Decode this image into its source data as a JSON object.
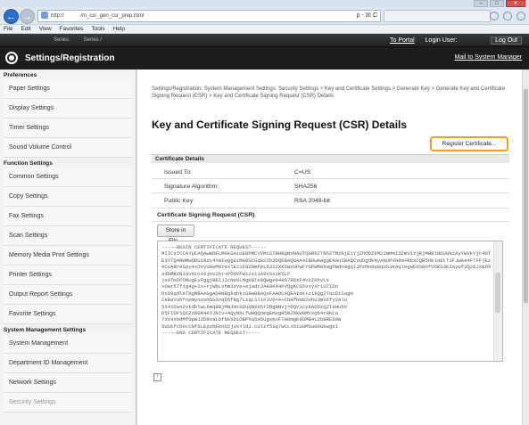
{
  "browser": {
    "url": "http://           /m_csr_gen_csr_prep.html",
    "address_tools": "ρ - ☒ C",
    "window_buttons": {
      "minimize": "–",
      "maximize": "□",
      "close": "✕"
    },
    "menu": [
      "File",
      "Edit",
      "View",
      "Favorites",
      "Tools",
      "Help"
    ]
  },
  "header": {
    "device_label": "Series          Series /",
    "to_portal": "To Portal",
    "login_user_label": "Login User:",
    "login_user_value": "       ",
    "logout": "Log Out",
    "mail": "Mail to System Manager",
    "title": "Settings/Registration"
  },
  "sidebar": {
    "sections": [
      {
        "heading": "Preferences",
        "items": [
          "Paper Settings",
          "Display Settings",
          "Timer Settings",
          "Sound Volume Control"
        ]
      },
      {
        "heading": "Function Settings",
        "items": [
          "Common Settings",
          "Copy Settings",
          "Fax Settings",
          "Scan Settings",
          "Memory Media Print Settings",
          "Printer Settings",
          "Output Report Settings",
          "Favorite Settings"
        ]
      },
      {
        "heading": "System Management Settings",
        "items": [
          "System Management",
          "Department ID Management",
          "Network Settings",
          "Security Settings"
        ]
      }
    ]
  },
  "main": {
    "breadcrumb": "Settings/Registration: System Management Settings: Security Settings > Key and Certificate Settings > Generate Key > Generate Key and Certificate Signing Request (CSR) > Key and Certificate Signing Request (CSR) Details",
    "title": "Key and Certificate Signing Request (CSR) Details",
    "register_button": "Register Certificate...",
    "cert_details_heading": "Certificate Details",
    "fields": [
      {
        "label": "Issued To:",
        "value": "C=US"
      },
      {
        "label": "Signature Algorithm:",
        "value": "SHA256"
      },
      {
        "label": "Public Key:",
        "value": "RSA 2048-bit"
      }
    ],
    "csr_heading": "Certificate Signing Request (CSR)",
    "store_button": "Store in File...",
    "csr_text": "-----BEGIN CERTIFICATE REQUEST-----\nMIICsTCCAYUCAQAwWDELMAkGA1UEBhMCVVMxSTBHBgNVBAUTQGRkZTNhZTMzNjE1YjZhODZkM2JmMmI3ZmViYjRjMWRlNDU0NzAyYWVkYjc4OTE3YTQ4NWMwODU1Nzc4YWIwggEiMA0GCSqGSIb3DQEBAQUAA4IBDwAwggEKAoIBAQCvUDgdkNyANUPVH9m+RbxCQB5OEla6tT1FJwAA4FTFFjEz0CvARr0Spy4+DvyU8eM9YeXlE21FGZ8mFpL5312XK5WXUPwFYOFwM8kwgPWdn9gqlJPzMn9q0qUS3KAqlegHE0SBOfVOKS3K3ayUf3Q26JxBD9sdDMBVNIAv9ics9jnx2hr+PDOVFW12x11A9VSx1K5LF\nje9TmIPDNUgEyPggjBBIJIcNeVLMgKBTe0QWge94e07RDxF4VzZGhvLs\n+Owr5Tf1g4g+2x+rjWbLvhm3zVo+ejadr2AK8K44hVQgKCG5vxyXr1U7IDn\nDx09qdleTAgMBAAGgADANBgkqhkiG9w0BAQsFAAOCAQEAtmt+z1kQg2TacDiSagm\nCeBaVuhfnpmyozom5G3nqD5fBg7LiqLSl1F3VO+e+CbHfbH82ehu3mX6fy2Alu\n5X41Dsn2vkdblwL6mq8BjMN3mtGDuqNX05r2RgNNVj=OQY1cy8ADDzQZTeHubV\nD5FIDF1Q1ZzR0R4KYJNlv+4QyNhLfwHQQnmqEmvgR5mZNkW8MVxpb4r8KCa\n7XVsnOdMfOpWJZDRvaLDfNk6D1DBPha5H5UgsKoFTH0mgK9DMB4L2bBRED9W\n5UukfcOocCNf6LEpzbEbnO2jVxYldJ.cUlzf5Sq7wCLx51UUM5a0OGbwgeI\n-----END CERTIFICATE REQUEST-----",
    "top_icon": "↑"
  }
}
